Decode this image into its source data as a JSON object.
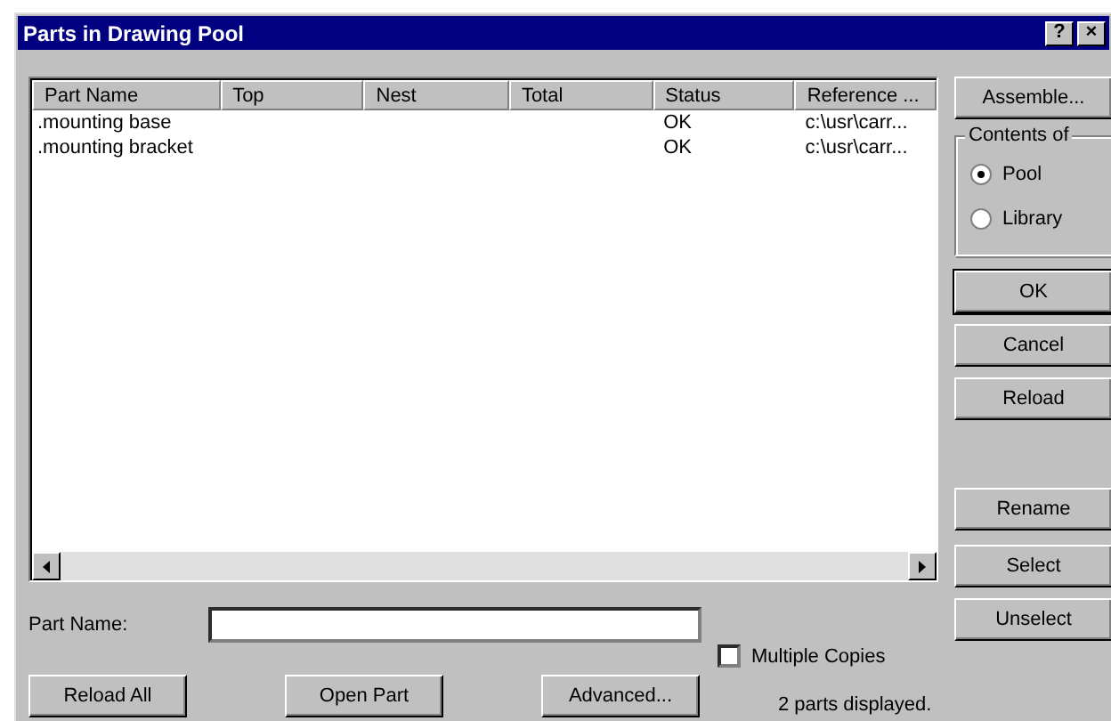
{
  "window": {
    "title": "Parts in Drawing Pool",
    "title_buttons": [
      "?",
      "×"
    ]
  },
  "table": {
    "columns": [
      "Part Name",
      "Top",
      "Nest",
      "Total",
      "Status",
      "Reference ..."
    ],
    "rows": [
      {
        "cells": [
          ".mounting base",
          "",
          "",
          "",
          "OK",
          "c:\\usr\\carr..."
        ]
      },
      {
        "cells": [
          ".mounting bracket",
          "",
          "",
          "",
          "OK",
          "c:\\usr\\carr..."
        ]
      }
    ]
  },
  "part_name": {
    "label": "Part Name:"
  },
  "multiple_copies": {
    "label": "Multiple Copies",
    "checked": false
  },
  "bottom_buttons": [
    "Reload All",
    "Open Part",
    "Advanced..."
  ],
  "status": "2 parts displayed.",
  "assemble_button": "Assemble...",
  "contents_of": {
    "label": "Contents of",
    "options": [
      {
        "label": "Pool",
        "selected": true
      },
      {
        "label": "Library",
        "selected": false
      }
    ]
  },
  "side_buttons": [
    {
      "label": "OK",
      "kind": "default"
    },
    {
      "label": "Cancel",
      "kind": "normal"
    },
    {
      "label": "Reload",
      "kind": "normal"
    },
    {
      "label": "Rename",
      "kind": "gap"
    },
    {
      "label": "Select",
      "kind": "normal"
    },
    {
      "label": "Unselect",
      "kind": "normal"
    }
  ]
}
